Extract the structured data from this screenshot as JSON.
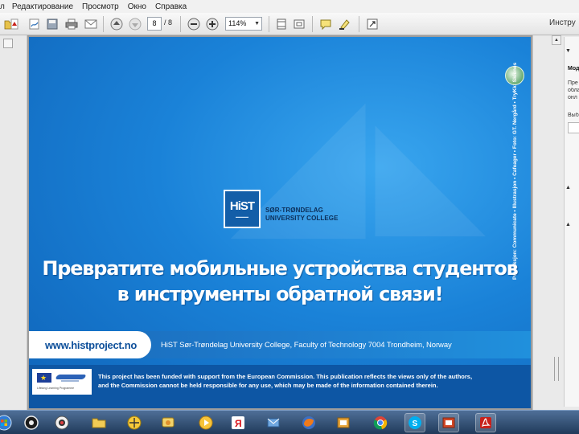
{
  "menu": {
    "items": [
      "л",
      "Редактирование",
      "Просмотр",
      "Окно",
      "Справка"
    ]
  },
  "toolbar": {
    "page_current": "8",
    "page_total": "/ 8",
    "zoom": "114%",
    "tools_label": "Инстру"
  },
  "document": {
    "logo_mark": "HiST",
    "logo_line1": "SØR-TRØNDELAG",
    "logo_line2": "UNIVERSITY COLLEGE",
    "headline_line1": "Превратите мобильные устройства студентов",
    "headline_line2": "в инструменты обратной связи!",
    "vertical_credit": "Produksjon: Communicate • Illustrasjon • Cafeager • Foto: GT. Nergård • TryKk: Skienes",
    "url": "www.histproject.no",
    "address": "HiST Sør-Trøndelag University College, Faculty of Technology 7004 Trondheim, Norway",
    "disclaimer_line1": "This project has been funded with support from the European Commission. This publication reflects the views only of the authors,",
    "disclaimer_line2": "and the Commission cannot be held responsible for any use, which may be made of the information contained therein.",
    "eu_caption": "Lifelong Learning Programme"
  },
  "right_panel": {
    "label_mode": "Мод",
    "text_lines": [
      "Пре",
      "обла",
      "онл"
    ],
    "label_select": "Выб"
  },
  "taskbar": {
    "apps": [
      "start",
      "chrome-like",
      "camera",
      "explorer",
      "maps",
      "messenger",
      "media-player",
      "yandex",
      "mail",
      "firefox",
      "gallery",
      "chrome",
      "skype",
      "presentation",
      "acrobat"
    ]
  },
  "colors": {
    "slide_blue": "#1a82d8",
    "footer_blue": "#0d56a4",
    "taskbar": "#203a5a"
  }
}
